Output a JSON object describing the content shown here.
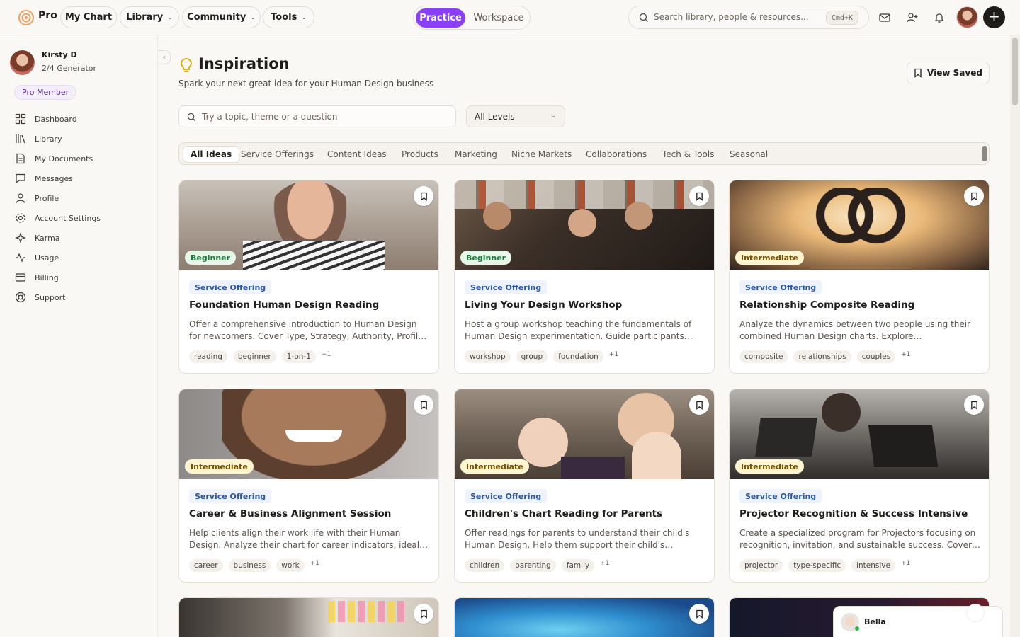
{
  "app": {
    "brand": "Pro"
  },
  "nav": {
    "my_chart": "My Chart",
    "library": "Library",
    "community": "Community",
    "tools": "Tools",
    "practice": "Practice",
    "workspace": "Workspace",
    "search_placeholder": "Search library, people & resources...",
    "shortcut": "Cmd+K"
  },
  "user": {
    "name": "Kirsty D",
    "type": "2/4 Generator",
    "badge": "Pro Member"
  },
  "sidebar": {
    "items": [
      {
        "label": "Dashboard",
        "icon": "grid-icon"
      },
      {
        "label": "Library",
        "icon": "books-icon"
      },
      {
        "label": "My Documents",
        "icon": "document-icon"
      },
      {
        "label": "Messages",
        "icon": "message-icon"
      },
      {
        "label": "Profile",
        "icon": "user-icon"
      },
      {
        "label": "Account Settings",
        "icon": "gear-icon"
      },
      {
        "label": "Karma",
        "icon": "sparkle-icon"
      },
      {
        "label": "Usage",
        "icon": "activity-icon"
      },
      {
        "label": "Billing",
        "icon": "card-icon"
      },
      {
        "label": "Support",
        "icon": "lifebuoy-icon"
      }
    ]
  },
  "page": {
    "title": "Inspiration",
    "subtitle": "Spark your next great idea for your Human Design business",
    "view_saved": "View Saved",
    "topic_placeholder": "Try a topic, theme or a question",
    "level_filter": "All Levels"
  },
  "tabs": [
    "All Ideas",
    "Service Offerings",
    "Content Ideas",
    "Products",
    "Marketing",
    "Niche Markets",
    "Collaborations",
    "Tech & Tools",
    "Seasonal"
  ],
  "cards": [
    {
      "level": "Beginner",
      "category": "Service Offering",
      "title": "Foundation Human Design Reading",
      "desc": "Offer a comprehensive introduction to Human Design for newcomers. Cover Type, Strategy, Authority, Profile, and key centers.",
      "tags": [
        "reading",
        "beginner",
        "1-on-1"
      ],
      "more": "+1"
    },
    {
      "level": "Beginner",
      "category": "Service Offering",
      "title": "Living Your Design Workshop",
      "desc": "Host a group workshop teaching the fundamentals of Human Design experimentation. Guide participants through their charts.",
      "tags": [
        "workshop",
        "group",
        "foundation"
      ],
      "more": "+1"
    },
    {
      "level": "Intermediate",
      "category": "Service Offering",
      "title": "Relationship Composite Reading",
      "desc": "Analyze the dynamics between two people using their combined Human Design charts. Explore electromagnetic connections.",
      "tags": [
        "composite",
        "relationships",
        "couples"
      ],
      "more": "+1"
    },
    {
      "level": "Intermediate",
      "category": "Service Offering",
      "title": "Career & Business Alignment Session",
      "desc": "Help clients align their work life with their Human Design. Analyze their chart for career indicators, ideal work environments.",
      "tags": [
        "career",
        "business",
        "work"
      ],
      "more": "+1"
    },
    {
      "level": "Intermediate",
      "category": "Service Offering",
      "title": "Children's Chart Reading for Parents",
      "desc": "Offer readings for parents to understand their child's Human Design. Help them support their child's authentic nature.",
      "tags": [
        "children",
        "parenting",
        "family"
      ],
      "more": "+1"
    },
    {
      "level": "Intermediate",
      "category": "Service Offering",
      "title": "Projector Recognition & Success Intensive",
      "desc": "Create a specialized program for Projectors focusing on recognition, invitation, and sustainable success. Cover energy management.",
      "tags": [
        "projector",
        "type-specific",
        "intensive"
      ],
      "more": "+1"
    }
  ],
  "chat": {
    "name": "Bella"
  },
  "colors": {
    "accent": "#8a3ffc",
    "beginner": "#1f7a3a",
    "intermediate": "#7a5300",
    "category": "#2856a6"
  }
}
